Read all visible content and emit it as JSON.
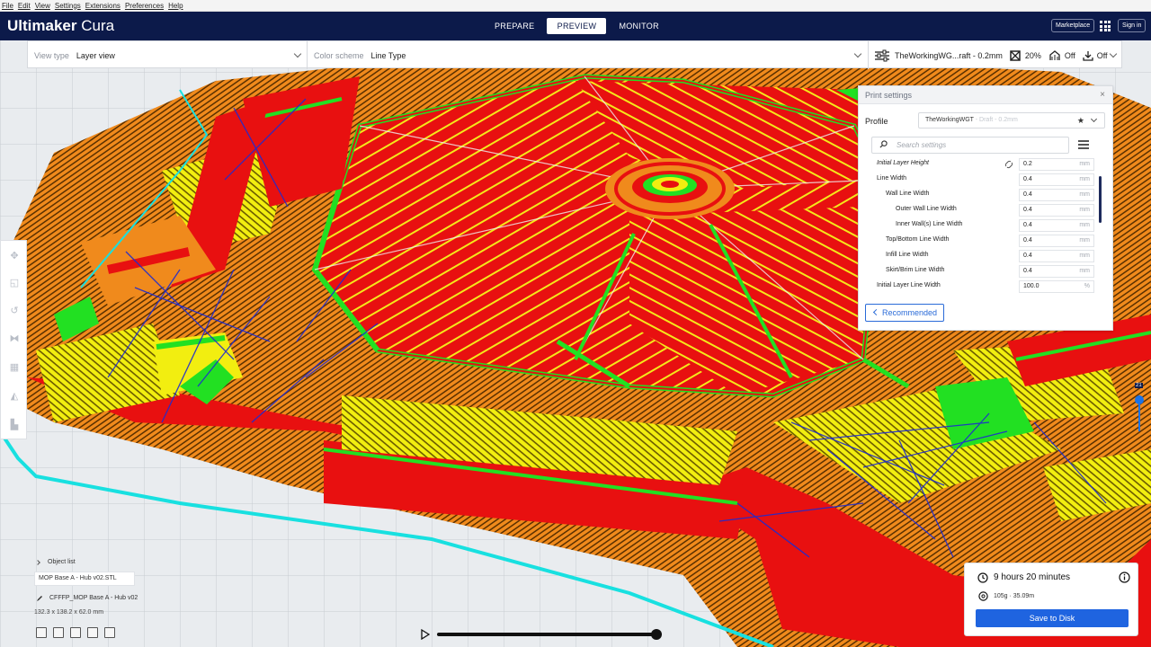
{
  "menu": [
    "File",
    "Edit",
    "View",
    "Settings",
    "Extensions",
    "Preferences",
    "Help"
  ],
  "header": {
    "brand_bold": "Ultimaker",
    "brand_light": " Cura",
    "stages": [
      "PREPARE",
      "PREVIEW",
      "MONITOR"
    ],
    "active_stage": "PREVIEW",
    "marketplace": "Marketplace",
    "signin": "Sign in"
  },
  "toolbar": {
    "view_type_label": "View type",
    "view_type_value": "Layer view",
    "color_scheme_label": "Color scheme",
    "color_scheme_value": "Line Type",
    "profile_summary": "TheWorkingWG...raft - 0.2mm",
    "infill": "20%",
    "support": "Off",
    "adhesion": "Off"
  },
  "panel": {
    "title": "Print settings",
    "close": "×",
    "profile_label": "Profile",
    "profile_name": "TheWorkingWGT",
    "profile_suffix": " - Draft - 0.2mm",
    "search_placeholder": "Search settings",
    "settings": [
      {
        "label": "Initial Layer Height",
        "value": "0.2",
        "unit": "mm",
        "indent": 0,
        "italic": true,
        "linked": true
      },
      {
        "label": "Line Width",
        "value": "0.4",
        "unit": "mm",
        "indent": 0,
        "italic": false,
        "linked": false
      },
      {
        "label": "Wall Line Width",
        "value": "0.4",
        "unit": "mm",
        "indent": 1,
        "italic": false,
        "linked": false
      },
      {
        "label": "Outer Wall Line Width",
        "value": "0.4",
        "unit": "mm",
        "indent": 2,
        "italic": false,
        "linked": false
      },
      {
        "label": "Inner Wall(s) Line Width",
        "value": "0.4",
        "unit": "mm",
        "indent": 2,
        "italic": false,
        "linked": false
      },
      {
        "label": "Top/Bottom Line Width",
        "value": "0.4",
        "unit": "mm",
        "indent": 1,
        "italic": false,
        "linked": false
      },
      {
        "label": "Infill Line Width",
        "value": "0.4",
        "unit": "mm",
        "indent": 1,
        "italic": false,
        "linked": false
      },
      {
        "label": "Skirt/Brim Line Width",
        "value": "0.4",
        "unit": "mm",
        "indent": 1,
        "italic": false,
        "linked": false
      },
      {
        "label": "Initial Layer Line Width",
        "value": "100.0",
        "unit": "%",
        "indent": 0,
        "italic": false,
        "linked": false
      }
    ],
    "recommended_button": "Recommended"
  },
  "objects": {
    "header": "Object list",
    "item": "MOP Base A - Hub v02.STL",
    "name": "CFFFP_MOP Base A - Hub v02",
    "dimensions": "132.3 x 138.2 x 62.0 mm"
  },
  "layer_slider": {
    "current_layer": "21"
  },
  "print_info": {
    "time": "9 hours 20 minutes",
    "material": "105g · 35.09m",
    "save_button": "Save to Disk"
  },
  "colors": {
    "header_bg": "#0c1a4a",
    "accent_blue": "#1f64e0",
    "wall_red": "#e81010",
    "wall_green": "#22e022",
    "skin_yellow": "#f2ee10",
    "infill_orange": "#f08a1c",
    "support_cyan": "#18e0e0",
    "travel_blue": "#1e2bd0"
  }
}
